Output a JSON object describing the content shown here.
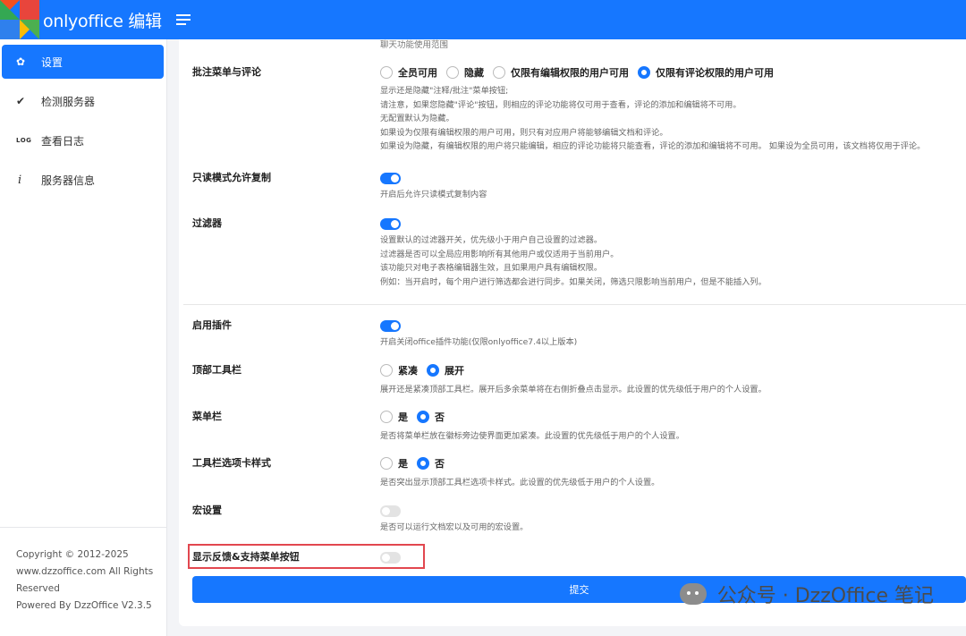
{
  "app": {
    "title": "onlyoffice 编辑"
  },
  "colors": {
    "primary": "#1677ff",
    "highlight": "#e2474f"
  },
  "sidebar": {
    "items": [
      {
        "label": "设置",
        "icon": "gear-icon",
        "active": true
      },
      {
        "label": "检测服务器",
        "icon": "check-icon",
        "active": false
      },
      {
        "label": "查看日志",
        "icon": "log-icon",
        "active": false
      },
      {
        "label": "服务器信息",
        "icon": "info-icon",
        "active": false
      }
    ],
    "footer": {
      "line1": "Copyright © 2012-2025",
      "line2": "www.dzzoffice.com All Rights",
      "line3": "Reserved",
      "line4": "Powered By DzzOffice V2.3.5"
    }
  },
  "main": {
    "top_desc": "聊天功能使用范围",
    "comments": {
      "label": "批注菜单与评论",
      "options": [
        "全员可用",
        "隐藏",
        "仅限有编辑权限的用户可用",
        "仅限有评论权限的用户可用"
      ],
      "selected": "仅限有评论权限的用户可用",
      "desc": [
        "显示还是隐藏\"注释/批注\"菜单按钮;",
        "请注意，如果您隐藏\"评论\"按钮，则相应的评论功能将仅可用于查看，评论的添加和编辑将不可用。",
        "无配置默认为隐藏。",
        "如果设为仅限有编辑权限的用户可用，则只有对应用户将能够编辑文档和评论。",
        "如果设为隐藏，有编辑权限的用户将只能编辑，相应的评论功能将只能查看，评论的添加和编辑将不可用。 如果设为全员可用，该文档将仅用于评论。"
      ]
    },
    "readonly_copy": {
      "label": "只读模式允许复制",
      "enabled": true,
      "desc": "开启后允许只读模式复制内容"
    },
    "filter": {
      "label": "过滤器",
      "enabled": true,
      "desc": [
        "设置默认的过滤器开关，优先级小于用户自己设置的过滤器。",
        "过滤器是否可以全局应用影响所有其他用户或仅适用于当前用户。",
        "该功能只对电子表格编辑器生效，且如果用户具有编辑权限。",
        "例如：当开启时，每个用户进行筛选都会进行同步。如果关闭，筛选只限影响当前用户，但是不能插入列。"
      ]
    },
    "plugins": {
      "label": "启用插件",
      "enabled": true,
      "desc": "开启关闭office插件功能(仅限onlyoffice7.4以上版本)"
    },
    "toolbar": {
      "label": "顶部工具栏",
      "options": [
        "紧凑",
        "展开"
      ],
      "selected": "展开",
      "desc": "展开还是紧凑顶部工具栏。展开后多余菜单将在右侧折叠点击显示。此设置的优先级低于用户的个人设置。"
    },
    "menubar": {
      "label": "菜单栏",
      "options": [
        "是",
        "否"
      ],
      "selected": "否",
      "desc": "是否将菜单栏放在徽标旁边使界面更加紧凑。此设置的优先级低于用户的个人设置。"
    },
    "tab_style": {
      "label": "工具栏选项卡样式",
      "options": [
        "是",
        "否"
      ],
      "selected": "否",
      "desc": "是否突出显示顶部工具栏选项卡样式。此设置的优先级低于用户的个人设置。"
    },
    "macros": {
      "label": "宏设置",
      "enabled": false,
      "desc": "是否可以运行文档宏以及可用的宏设置。"
    },
    "feedback": {
      "label": "显示反馈&支持菜单按钮",
      "enabled": false
    },
    "submit_label": "提交"
  },
  "watermark": {
    "text": "公众号 · DzzOffice 笔记",
    "icon": "wechat-icon"
  }
}
